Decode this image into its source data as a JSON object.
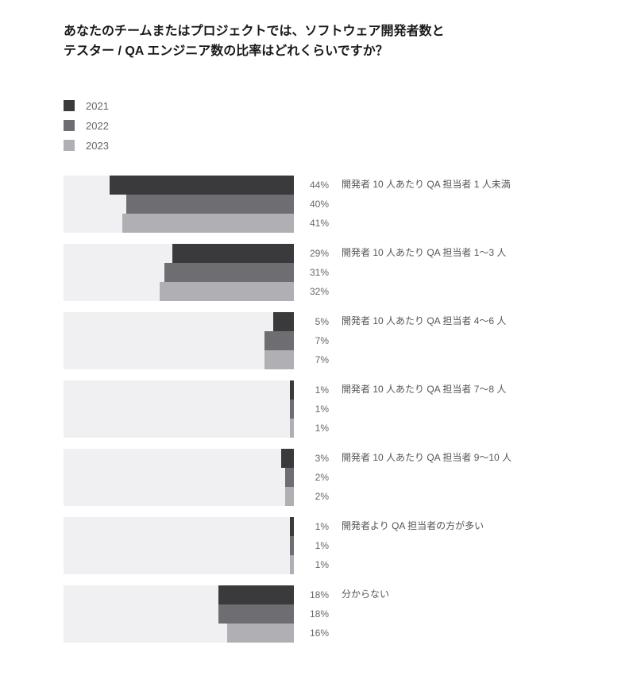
{
  "title": "あなたのチームまたはプロジェクトでは、ソフトウェア開発者数とテスター / QA エンジニア数の比率はどれくらいですか？",
  "legend": [
    {
      "label": "2021",
      "class": "c-2021"
    },
    {
      "label": "2022",
      "class": "c-2022"
    },
    {
      "label": "2023",
      "class": "c-2023"
    }
  ],
  "chart_data": {
    "type": "bar",
    "orientation": "horizontal",
    "series_names": [
      "2021",
      "2022",
      "2023"
    ],
    "series_colors": [
      "#3a3a3c",
      "#6e6e72",
      "#b0b0b4"
    ],
    "max_domain": 55,
    "categories": [
      {
        "label": "開発者 10 人あたり QA 担当者 1 人未満",
        "values": [
          44,
          40,
          41
        ]
      },
      {
        "label": "開発者 10 人あたり QA 担当者 1〜3 人",
        "values": [
          29,
          31,
          32
        ]
      },
      {
        "label": "開発者 10 人あたり QA 担当者 4〜6 人",
        "values": [
          5,
          7,
          7
        ]
      },
      {
        "label": "開発者 10 人あたり QA 担当者 7〜8 人",
        "values": [
          1,
          1,
          1
        ]
      },
      {
        "label": "開発者 10 人あたり QA 担当者 9〜10 人",
        "values": [
          3,
          2,
          2
        ]
      },
      {
        "label": "開発者より QA 担当者の方が多い",
        "values": [
          1,
          1,
          1
        ]
      },
      {
        "label": "分からない",
        "values": [
          18,
          18,
          16
        ]
      }
    ]
  }
}
